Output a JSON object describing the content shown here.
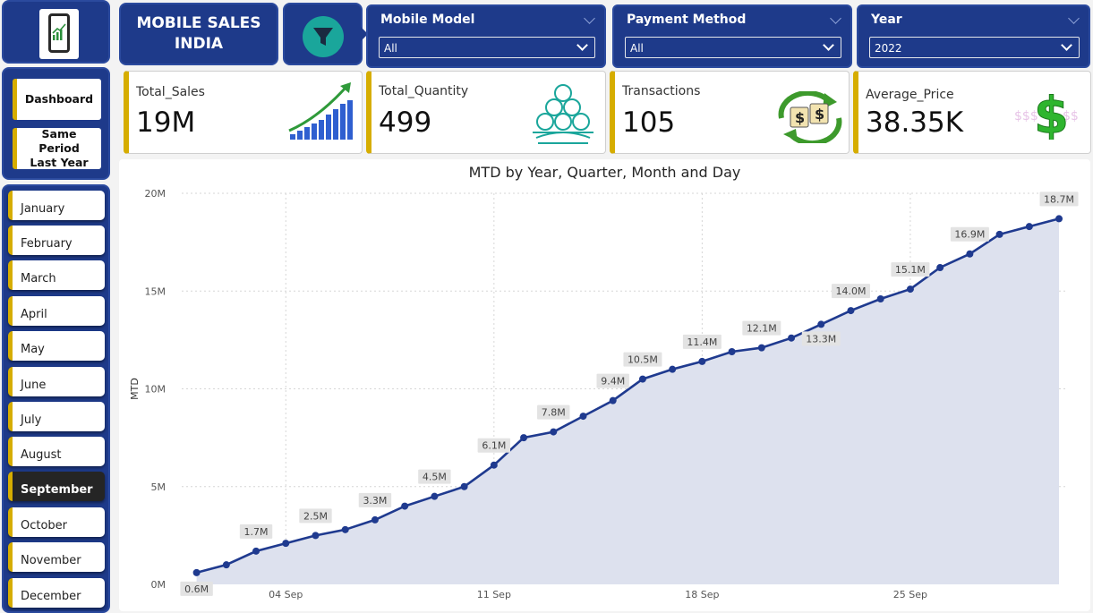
{
  "header": {
    "title_line1": "MOBILE SALES",
    "title_line2": "INDIA"
  },
  "filters": [
    {
      "label": "Mobile Model",
      "value": "All"
    },
    {
      "label": "Payment Method",
      "value": "All"
    },
    {
      "label": "Year",
      "value": "2022"
    }
  ],
  "nav": {
    "dashboard": "Dashboard",
    "same_period": "Same Period Last Year"
  },
  "months": [
    "January",
    "February",
    "March",
    "April",
    "May",
    "June",
    "July",
    "August",
    "September",
    "October",
    "November",
    "December"
  ],
  "active_month": "September",
  "kpis": [
    {
      "label": "Total_Sales",
      "value": "19M",
      "icon": "bar-growth-icon"
    },
    {
      "label": "Total_Quantity",
      "value": "499",
      "icon": "stack-coins-icon"
    },
    {
      "label": "Transactions",
      "value": "105",
      "icon": "money-exchange-icon"
    },
    {
      "label": "Average_Price",
      "value": "38.35K",
      "icon": "dollar-sign-icon"
    }
  ],
  "colors": {
    "navy": "#1e3a8a",
    "accent": "#d6ad00",
    "line": "#1f3a8f",
    "area": "#dde1ee",
    "teal": "#1aa69b"
  },
  "chart_data": {
    "type": "area",
    "title": "MTD by Year, Quarter, Month and Day",
    "ylabel": "MTD",
    "xlabel": "",
    "ylim": [
      0,
      20
    ],
    "yunit": "M",
    "yticks": [
      "0M",
      "5M",
      "10M",
      "15M",
      "20M"
    ],
    "xticks": [
      {
        "day": 4,
        "label": "04 Sep"
      },
      {
        "day": 11,
        "label": "11 Sep"
      },
      {
        "day": 18,
        "label": "18 Sep"
      },
      {
        "day": 25,
        "label": "25 Sep"
      }
    ],
    "x": [
      1,
      2,
      3,
      4,
      5,
      6,
      7,
      8,
      9,
      10,
      11,
      12,
      13,
      14,
      15,
      16,
      17,
      18,
      19,
      20,
      21,
      22,
      23,
      24,
      25,
      26,
      27,
      28,
      29,
      30
    ],
    "values": [
      0.6,
      1.0,
      1.7,
      2.1,
      2.5,
      2.8,
      3.3,
      4.0,
      4.5,
      5.0,
      6.1,
      7.5,
      7.8,
      8.6,
      9.4,
      10.5,
      11.0,
      11.4,
      11.9,
      12.1,
      12.6,
      13.3,
      14.0,
      14.6,
      15.1,
      16.2,
      16.9,
      17.9,
      18.3,
      18.7
    ],
    "data_labels": [
      {
        "day": 1,
        "text": "0.6M"
      },
      {
        "day": 3,
        "text": "1.7M"
      },
      {
        "day": 5,
        "text": "2.5M"
      },
      {
        "day": 7,
        "text": "3.3M"
      },
      {
        "day": 9,
        "text": "4.5M"
      },
      {
        "day": 11,
        "text": "6.1M"
      },
      {
        "day": 13,
        "text": "7.8M"
      },
      {
        "day": 15,
        "text": "9.4M"
      },
      {
        "day": 16,
        "text": "10.5M"
      },
      {
        "day": 18,
        "text": "11.4M"
      },
      {
        "day": 20,
        "text": "12.1M"
      },
      {
        "day": 22,
        "text": "13.3M"
      },
      {
        "day": 23,
        "text": "14.0M"
      },
      {
        "day": 25,
        "text": "15.1M"
      },
      {
        "day": 27,
        "text": "16.9M"
      },
      {
        "day": 30,
        "text": "18.7M"
      }
    ],
    "grid": true
  }
}
